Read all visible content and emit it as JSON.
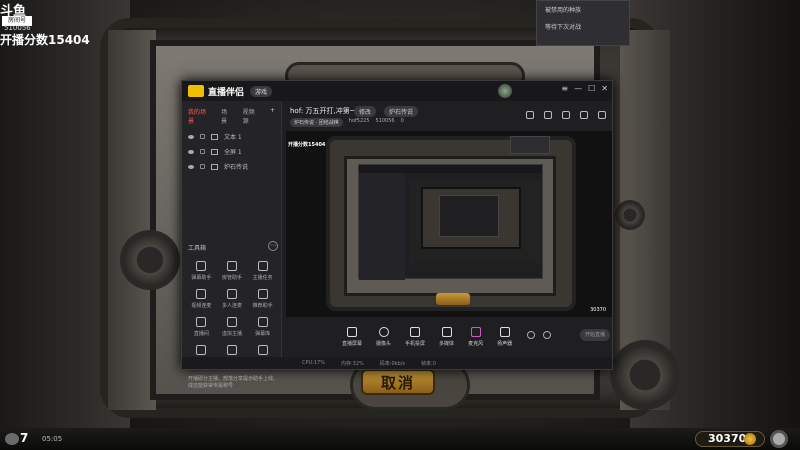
{
  "overlay": {
    "logo": "斗鱼",
    "room_tag": "房间号",
    "room_num": "510056",
    "score": "开播分数15404"
  },
  "top_panel": {
    "row1": "被禁用的种族",
    "row2": "等待下次对战"
  },
  "game": {
    "cancel": "取消",
    "count": "7",
    "time": "05:05",
    "gold": "30370"
  },
  "app": {
    "name": "直播伴侣",
    "badge": "游戏",
    "win_ctrls": [
      "≡",
      "—",
      "☐",
      "✕"
    ],
    "sidebar_tabs": [
      "我的场景",
      "场景",
      "视频源"
    ],
    "sources": [
      "文本 1",
      "全屏 1",
      "炉石传说"
    ],
    "tools_title": "工具箱",
    "tools": [
      "弹幕助手",
      "房管助手",
      "主播任务",
      "视频连麦",
      "多人连麦",
      "推荐助手",
      "直播间",
      "虚拟主播",
      "弹幕库",
      "",
      "",
      ""
    ],
    "header_title": "hof: 万五开打,冲第一",
    "header_btn1": "修改",
    "header_btn2": "炉石传说",
    "header_row2": [
      "炉石传说 · 团结战棋",
      "hof5225",
      "510056",
      "0"
    ],
    "preview_score": "开播分数15404",
    "preview_gold": "30370",
    "bottom_tools": [
      "直播屏幕",
      "摄像头",
      "手机投屏",
      "多媒体",
      "麦克风",
      "扬声器"
    ],
    "start_btn": "开始直播",
    "status": [
      "CPU:17%",
      "内存:32%",
      "码率:0kb/s",
      "帧率:0"
    ],
    "notice": "开播即分主播、部落分享提示助手上线、成还能获得专属称号"
  }
}
